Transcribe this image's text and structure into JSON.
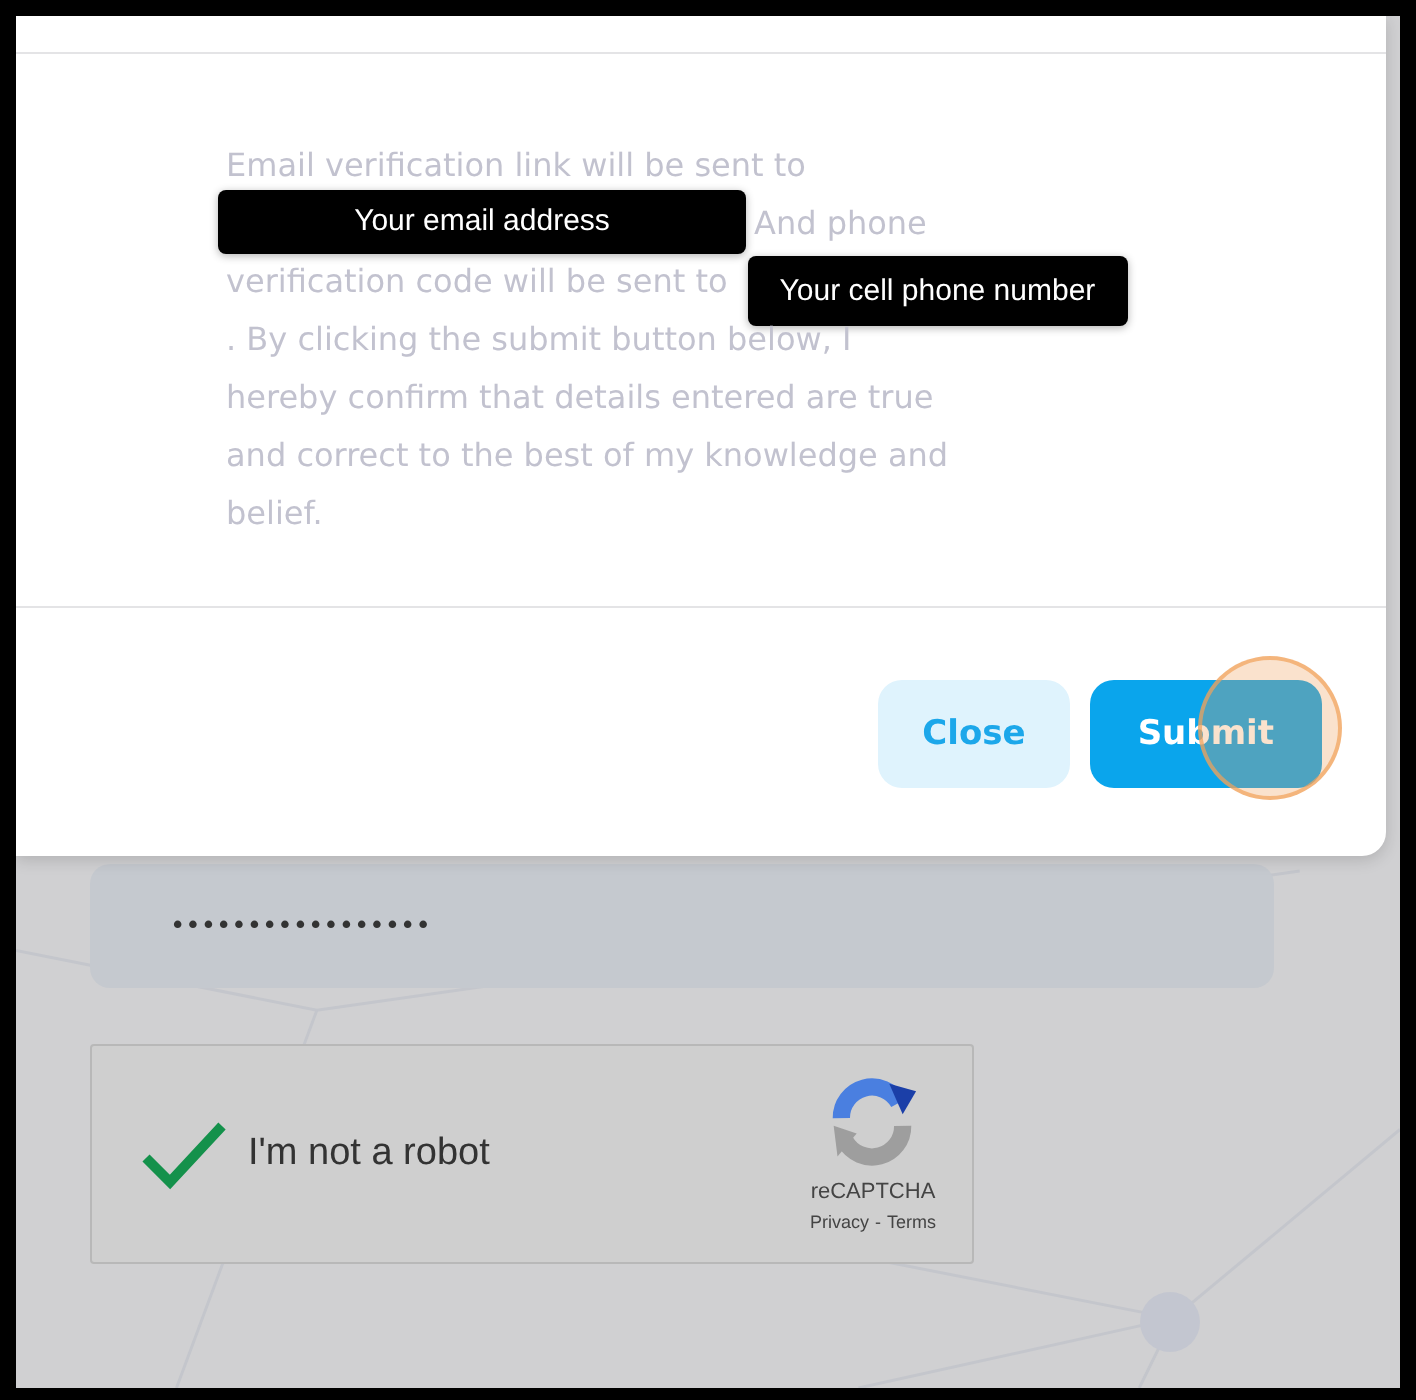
{
  "dialog": {
    "message_lines": [
      {
        "text": "Email verification link will be sent to"
      },
      {
        "tooltip": "Your email address",
        "text": "And phone"
      },
      {
        "text": "verification code will be sent to",
        "tooltip_after": "Your cell phone number"
      },
      {
        "text": ". By clicking the submit button below, I"
      },
      {
        "text": "hereby confirm that details entered are true"
      },
      {
        "text": "and correct to the best of my knowledge and"
      },
      {
        "text": "belief."
      }
    ],
    "buttons": [
      {
        "label": "Close",
        "kind": "secondary"
      },
      {
        "label": "Submit",
        "kind": "primary"
      }
    ]
  },
  "password_field": {
    "value": "•••••••••••••••••"
  },
  "recaptcha": {
    "label": "I'm not a robot",
    "checked": true,
    "brand": "reCAPTCHA",
    "privacy": "Privacy",
    "separator": "-",
    "terms": "Terms"
  }
}
